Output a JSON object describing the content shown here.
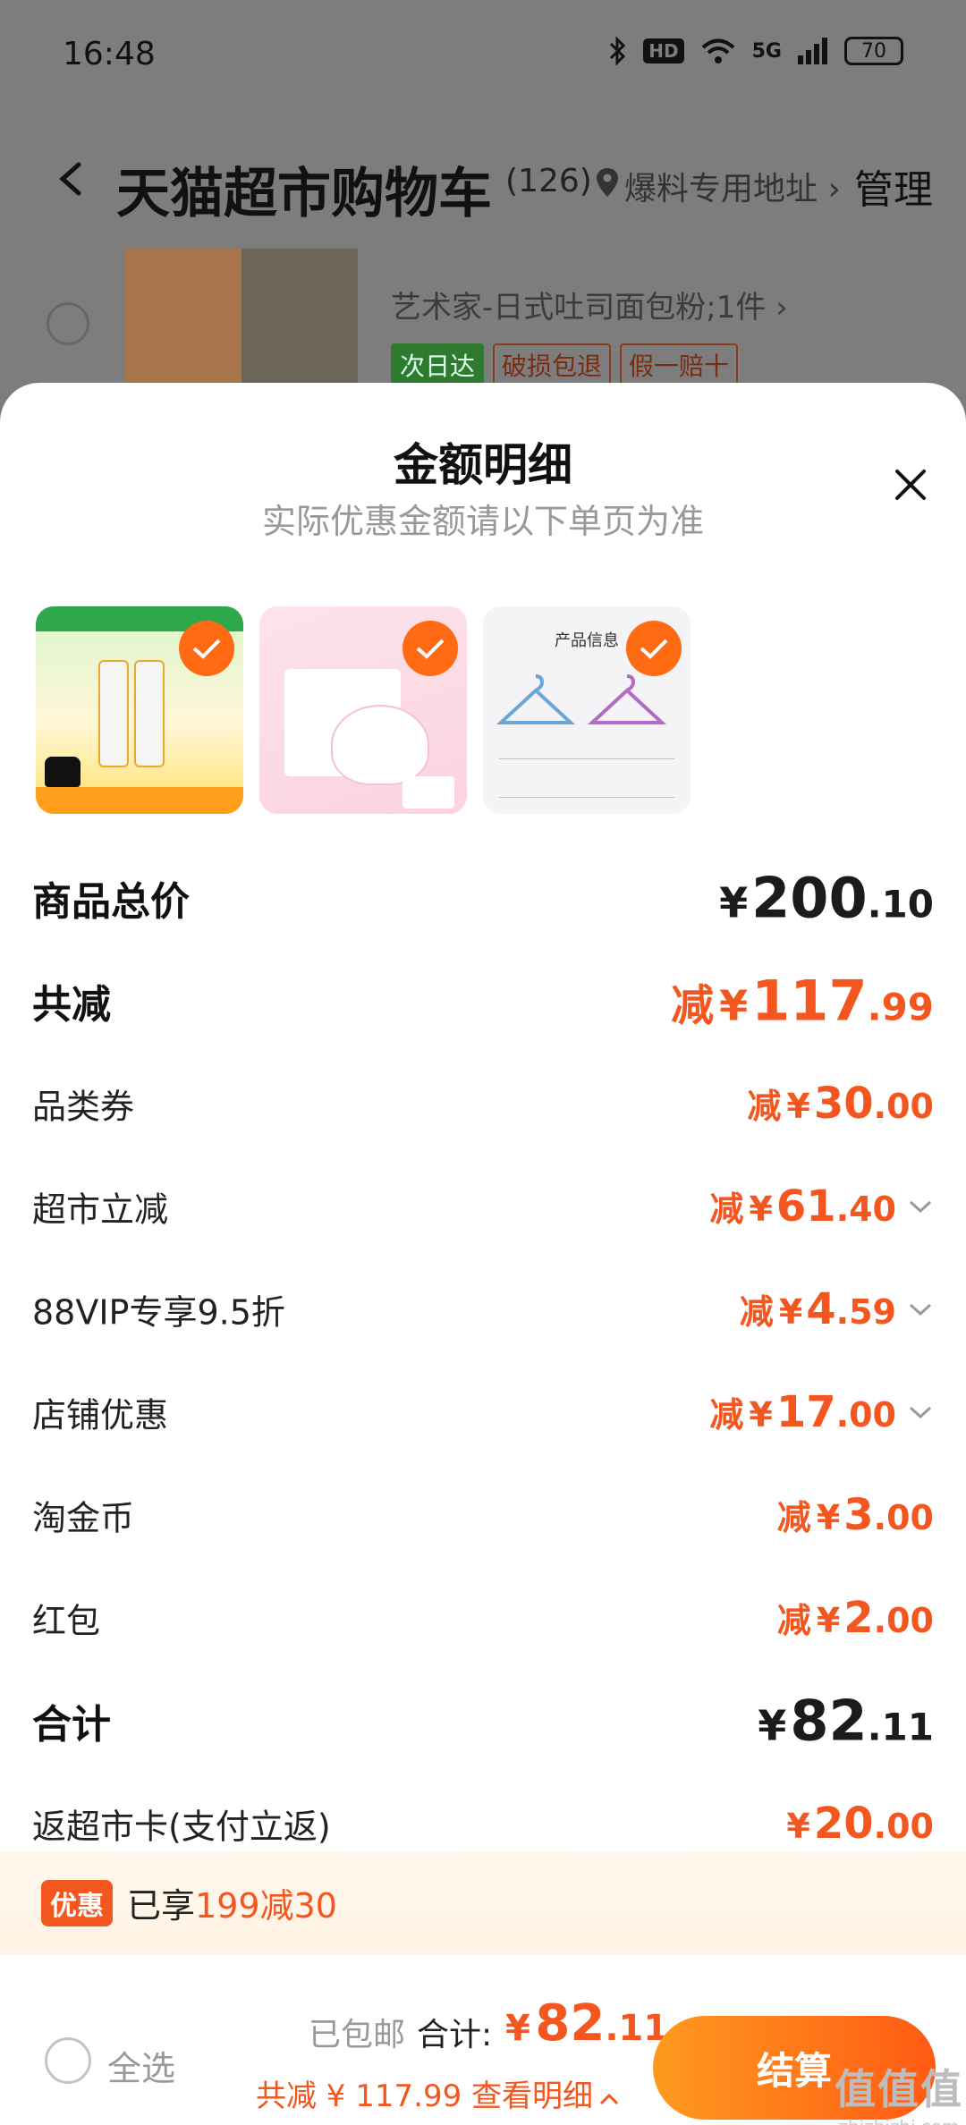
{
  "status_bar": {
    "time": "16:48",
    "hd": "HD",
    "network": "5G",
    "battery": "70"
  },
  "header": {
    "title": "天猫超市购物车",
    "count": "(126)",
    "address": "爆料专用地址 ›",
    "manage": "管理"
  },
  "background_item": {
    "sku": "艺术家-日式吐司面包粉;1件 ›",
    "tags": [
      "次日达",
      "破损包退",
      "假一赔十"
    ]
  },
  "sheet": {
    "title": "金额明细",
    "subtitle": "实际优惠金额请以下单页为准",
    "products": [
      {
        "name": "toothpaste-product"
      },
      {
        "name": "mask-product"
      },
      {
        "name": "hanger-product",
        "caption": "产品信息"
      }
    ],
    "rows": [
      {
        "label": "商品总价",
        "prefix": "",
        "yen": "¥",
        "int": "200",
        "dec": ".10",
        "color": "dark",
        "style": "big bold",
        "chevron": false
      },
      {
        "label": "共减",
        "prefix": "减",
        "yen": "¥",
        "int": "117",
        "dec": ".99",
        "color": "orange",
        "style": "big bold",
        "chevron": false
      },
      {
        "label": "品类券",
        "prefix": "减",
        "yen": "¥",
        "int": "30",
        "dec": ".00",
        "color": "orange",
        "style": "",
        "chevron": false
      },
      {
        "label": "超市立减",
        "prefix": "减",
        "yen": "¥",
        "int": "61",
        "dec": ".40",
        "color": "orange",
        "style": "",
        "chevron": true
      },
      {
        "label": "88VIP专享9.5折",
        "prefix": "减",
        "yen": "¥",
        "int": "4",
        "dec": ".59",
        "color": "orange",
        "style": "",
        "chevron": true
      },
      {
        "label": "店铺优惠",
        "prefix": "减",
        "yen": "¥",
        "int": "17",
        "dec": ".00",
        "color": "orange",
        "style": "",
        "chevron": true
      },
      {
        "label": "淘金币",
        "prefix": "减",
        "yen": "¥",
        "int": "3",
        "dec": ".00",
        "color": "orange",
        "style": "",
        "chevron": false
      },
      {
        "label": "红包",
        "prefix": "减",
        "yen": "¥",
        "int": "2",
        "dec": ".00",
        "color": "orange",
        "style": "",
        "chevron": false
      },
      {
        "label": "合计",
        "prefix": "",
        "yen": "¥",
        "int": "82",
        "dec": ".11",
        "color": "dark",
        "style": "big bold",
        "chevron": false
      },
      {
        "label": "返超市卡(支付立返)",
        "prefix": "",
        "yen": "¥",
        "int": "20",
        "dec": ".00",
        "color": "orange",
        "style": "",
        "chevron": false
      }
    ]
  },
  "promo": {
    "badge": "优惠",
    "text_prefix": "已享",
    "text_highlight": "199减30"
  },
  "bottom_bar": {
    "select_all": "全选",
    "free_shipping": "已包邮",
    "total_label": "合计:",
    "total_yen": "¥",
    "total_int": "82",
    "total_dec": ".11",
    "saved_text": "共减 ¥ 117.99",
    "view_detail": "查看明细",
    "checkout": "结算"
  },
  "watermark": {
    "main": "值值值",
    "sub": "zhizhizhi.com"
  },
  "colors": {
    "accent": "#f4561f",
    "checkout_start": "#ff9a1f",
    "checkout_end": "#ff5a14"
  }
}
